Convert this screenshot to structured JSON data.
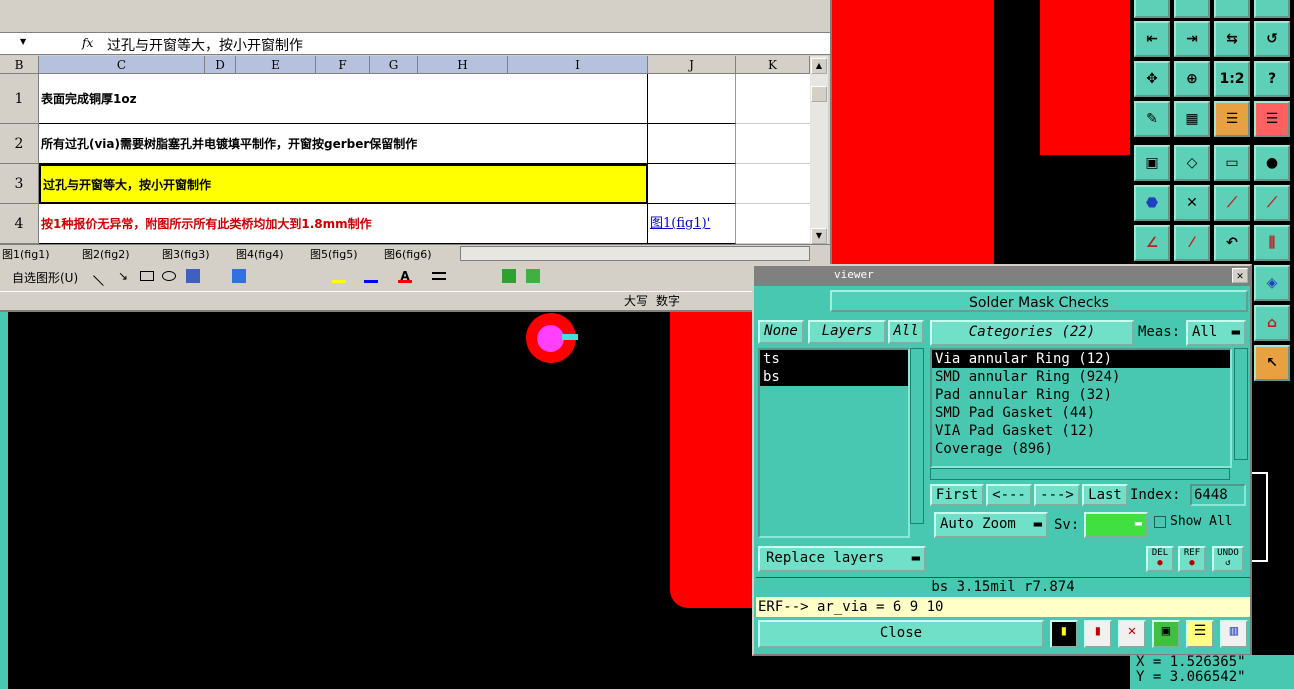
{
  "excel": {
    "formula_text": "过孔与开窗等大，按小开窗制作",
    "fx_label": "fx",
    "columns": [
      "B",
      "C",
      "D",
      "E",
      "F",
      "G",
      "H",
      "I",
      "J",
      "K"
    ],
    "rows": [
      {
        "num": "1",
        "text": "表面完成铜厚1oz",
        "color": "#000000",
        "bg": "#ffffff"
      },
      {
        "num": "2",
        "text": "所有过孔(via)需要树脂塞孔并电镀填平制作，开窗按gerber保留制作",
        "color": "#000000",
        "bg": "#ffffff"
      },
      {
        "num": "3",
        "text": "过孔与开窗等大，按小开窗制作",
        "color": "#000000",
        "bg": "#ffff00"
      },
      {
        "num": "4",
        "text": "按1种报价无异常，附图所示所有此类桥均加大到1.8mm制作",
        "color": "#cc0000",
        "bg": "#ffffff"
      }
    ],
    "link_text": "图1(fig1)'",
    "sheet_tabs": [
      "图1(fig1)",
      "图2(fig2)",
      "图3(fig3)",
      "图4(fig4)",
      "图5(fig5)",
      "图6(fig6)"
    ],
    "drawbar_label": "自选图形(U)",
    "status_caps": "大写",
    "status_num": "数字"
  },
  "dialog": {
    "title_fragment": "viewer",
    "title": "Solder Mask Checks",
    "none_label": "None",
    "layers_label": "Layers",
    "all_label": "All",
    "categories_label": "Categories (22)",
    "meas_label": "Meas:",
    "meas_value": "All",
    "layers": [
      {
        "name": "ts",
        "selected": true
      },
      {
        "name": "bs",
        "selected": true
      }
    ],
    "categories": [
      {
        "name": "Via annular Ring (12)",
        "selected": true
      },
      {
        "name": "SMD annular Ring (924)",
        "selected": false
      },
      {
        "name": "Pad annular Ring (32)",
        "selected": false
      },
      {
        "name": "SMD Pad Gasket (44)",
        "selected": false
      },
      {
        "name": "VIA Pad Gasket (12)",
        "selected": false
      },
      {
        "name": "Coverage (896)",
        "selected": false
      }
    ],
    "first_label": "First",
    "prev_label": "<---",
    "next_label": "--->",
    "last_label": "Last",
    "index_label": "Index:",
    "index_value": "6448",
    "auto_zoom_label": "Auto Zoom",
    "sv_label": "Sv:",
    "show_all_label": "Show All",
    "replace_layers_label": "Replace layers",
    "del_label": "DEL",
    "ref_label": "REF",
    "undo_label": "UNDO",
    "info_text": "bs 3.15mil  r7.874",
    "erf_text": "ERF--> ar_via = 6 9 10",
    "close_label": "Close"
  },
  "toolbar": {
    "zoom_label": "1:2",
    "help_label": "?"
  },
  "coords": {
    "x": "X = 1.526365\"",
    "y": "Y = 3.066542\""
  }
}
